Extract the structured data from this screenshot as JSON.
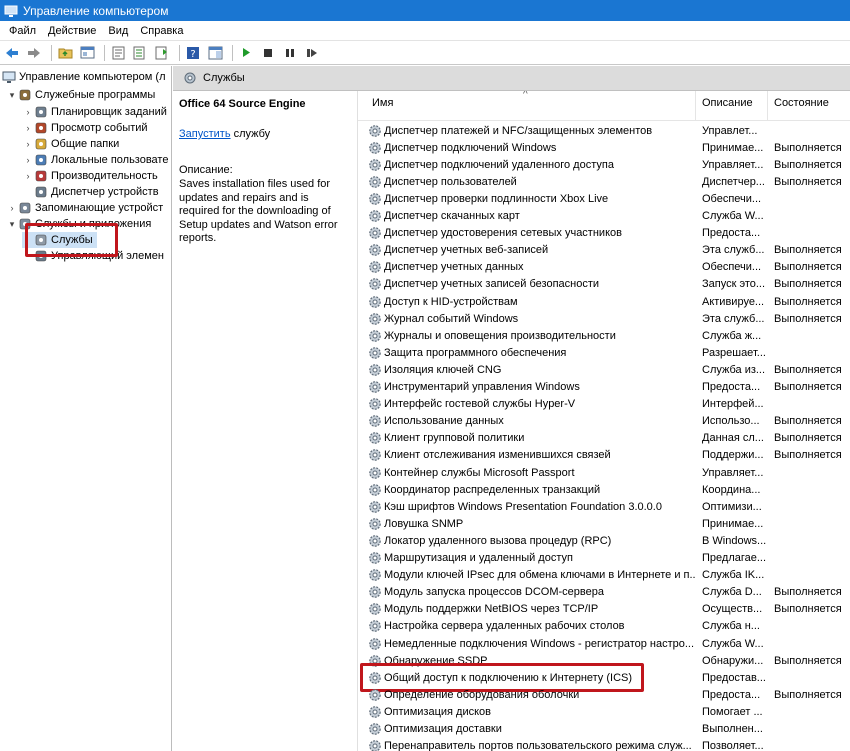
{
  "window": {
    "title": "Управление компьютером"
  },
  "menu": [
    "Файл",
    "Действие",
    "Вид",
    "Справка"
  ],
  "toolbar_icons": [
    "back-arrow-icon",
    "forward-arrow-icon",
    "up-folder-icon",
    "show-tree-icon",
    "properties-icon",
    "export-icon",
    "refresh-icon",
    "help-icon",
    "details-view-icon",
    "play-icon",
    "stop-icon",
    "pause-icon",
    "restart-icon"
  ],
  "tree": {
    "root": "Управление компьютером (л",
    "items": [
      {
        "label": "Служебные программы",
        "level": 1,
        "arrow": "▾",
        "icon": "tools-icon"
      },
      {
        "label": "Планировщик заданий",
        "level": 2,
        "arrow": "›",
        "icon": "clock-icon"
      },
      {
        "label": "Просмотр событий",
        "level": 2,
        "arrow": "›",
        "icon": "event-viewer-icon"
      },
      {
        "label": "Общие папки",
        "level": 2,
        "arrow": "›",
        "icon": "shared-folder-icon"
      },
      {
        "label": "Локальные пользовате",
        "level": 2,
        "arrow": "›",
        "icon": "users-icon"
      },
      {
        "label": "Производительность",
        "level": 2,
        "arrow": "›",
        "icon": "performance-icon"
      },
      {
        "label": "Диспетчер устройств",
        "level": 2,
        "arrow": "",
        "icon": "device-manager-icon"
      },
      {
        "label": "Запоминающие устройст",
        "level": 1,
        "arrow": "›",
        "icon": "storage-icon"
      },
      {
        "label": "Службы и приложения",
        "level": 1,
        "arrow": "▾",
        "icon": "services-apps-icon"
      },
      {
        "label": "Службы",
        "level": 2,
        "arrow": "",
        "icon": "gear-icon",
        "selected": true
      },
      {
        "label": "Управляющий элемен",
        "level": 2,
        "arrow": "",
        "icon": "wmi-control-icon"
      }
    ]
  },
  "header": {
    "title": "Службы"
  },
  "details": {
    "service_name": "Office 64 Source Engine",
    "action_link": "Запустить",
    "action_rest": " службу",
    "description_label": "Описание:",
    "description": "Saves installation files used for updates and repairs and is required for the downloading of Setup updates and Watson error reports."
  },
  "columns": {
    "name": "Имя",
    "description": "Описание",
    "status": "Состояние"
  },
  "services": [
    {
      "name": "Диспетчер платежей и NFC/защищенных элементов",
      "description": "Управлет...",
      "status": ""
    },
    {
      "name": "Диспетчер подключений Windows",
      "description": "Принимае...",
      "status": "Выполняется"
    },
    {
      "name": "Диспетчер подключений удаленного доступа",
      "description": "Управляет...",
      "status": "Выполняется"
    },
    {
      "name": "Диспетчер пользователей",
      "description": "Диспетчер...",
      "status": "Выполняется"
    },
    {
      "name": "Диспетчер проверки подлинности Xbox Live",
      "description": "Обеспечи...",
      "status": ""
    },
    {
      "name": "Диспетчер скачанных карт",
      "description": "Служба W...",
      "status": ""
    },
    {
      "name": "Диспетчер удостоверения сетевых участников",
      "description": "Предоста...",
      "status": ""
    },
    {
      "name": "Диспетчер учетных веб-записей",
      "description": "Эта служб...",
      "status": "Выполняется"
    },
    {
      "name": "Диспетчер учетных данных",
      "description": "Обеспечи...",
      "status": "Выполняется"
    },
    {
      "name": "Диспетчер учетных записей безопасности",
      "description": "Запуск это...",
      "status": "Выполняется"
    },
    {
      "name": "Доступ к HID-устройствам",
      "description": "Активируе...",
      "status": "Выполняется"
    },
    {
      "name": "Журнал событий Windows",
      "description": "Эта служб...",
      "status": "Выполняется"
    },
    {
      "name": "Журналы и оповещения производительности",
      "description": "Служба ж...",
      "status": ""
    },
    {
      "name": "Защита программного обеспечения",
      "description": "Разрешает...",
      "status": ""
    },
    {
      "name": "Изоляция ключей CNG",
      "description": "Служба из...",
      "status": "Выполняется"
    },
    {
      "name": "Инструментарий управления Windows",
      "description": "Предоста...",
      "status": "Выполняется"
    },
    {
      "name": "Интерфейс гостевой службы Hyper-V",
      "description": "Интерфей...",
      "status": ""
    },
    {
      "name": "Использование данных",
      "description": "Использо...",
      "status": "Выполняется"
    },
    {
      "name": "Клиент групповой политики",
      "description": "Данная сл...",
      "status": "Выполняется"
    },
    {
      "name": "Клиент отслеживания изменившихся связей",
      "description": "Поддержи...",
      "status": "Выполняется"
    },
    {
      "name": "Контейнер службы Microsoft Passport",
      "description": "Управляет...",
      "status": ""
    },
    {
      "name": "Координатор распределенных транзакций",
      "description": "Координа...",
      "status": ""
    },
    {
      "name": "Кэш шрифтов Windows Presentation Foundation 3.0.0.0",
      "description": "Оптимизи...",
      "status": ""
    },
    {
      "name": "Ловушка SNMP",
      "description": "Принимае...",
      "status": ""
    },
    {
      "name": "Локатор удаленного вызова процедур (RPC)",
      "description": "В Windows...",
      "status": ""
    },
    {
      "name": "Маршрутизация и удаленный доступ",
      "description": "Предлагае...",
      "status": ""
    },
    {
      "name": "Модули ключей IPsec для обмена ключами в Интернете и п...",
      "description": "Служба IK...",
      "status": ""
    },
    {
      "name": "Модуль запуска процессов DCOM-сервера",
      "description": "Служба D...",
      "status": "Выполняется"
    },
    {
      "name": "Модуль поддержки NetBIOS через TCP/IP",
      "description": "Осуществ...",
      "status": "Выполняется"
    },
    {
      "name": "Настройка сервера удаленных рабочих столов",
      "description": "Служба н...",
      "status": ""
    },
    {
      "name": "Немедленные подключения Windows - регистратор настро...",
      "description": "Служба W...",
      "status": ""
    },
    {
      "name": "Обнаружение SSDP",
      "description": "Обнаружи...",
      "status": "Выполняется"
    },
    {
      "name": "Общий доступ к подключению к Интернету (ICS)",
      "description": "Предостав...",
      "status": "",
      "highlighted": true
    },
    {
      "name": "Определение оборудования оболочки",
      "description": "Предоста...",
      "status": "Выполняется"
    },
    {
      "name": "Оптимизация дисков",
      "description": "Помогает ...",
      "status": ""
    },
    {
      "name": "Оптимизация доставки",
      "description": "Выполнен...",
      "status": ""
    },
    {
      "name": "Перенаправитель портов пользовательского режима служ...",
      "description": "Позволяет...",
      "status": ""
    }
  ]
}
